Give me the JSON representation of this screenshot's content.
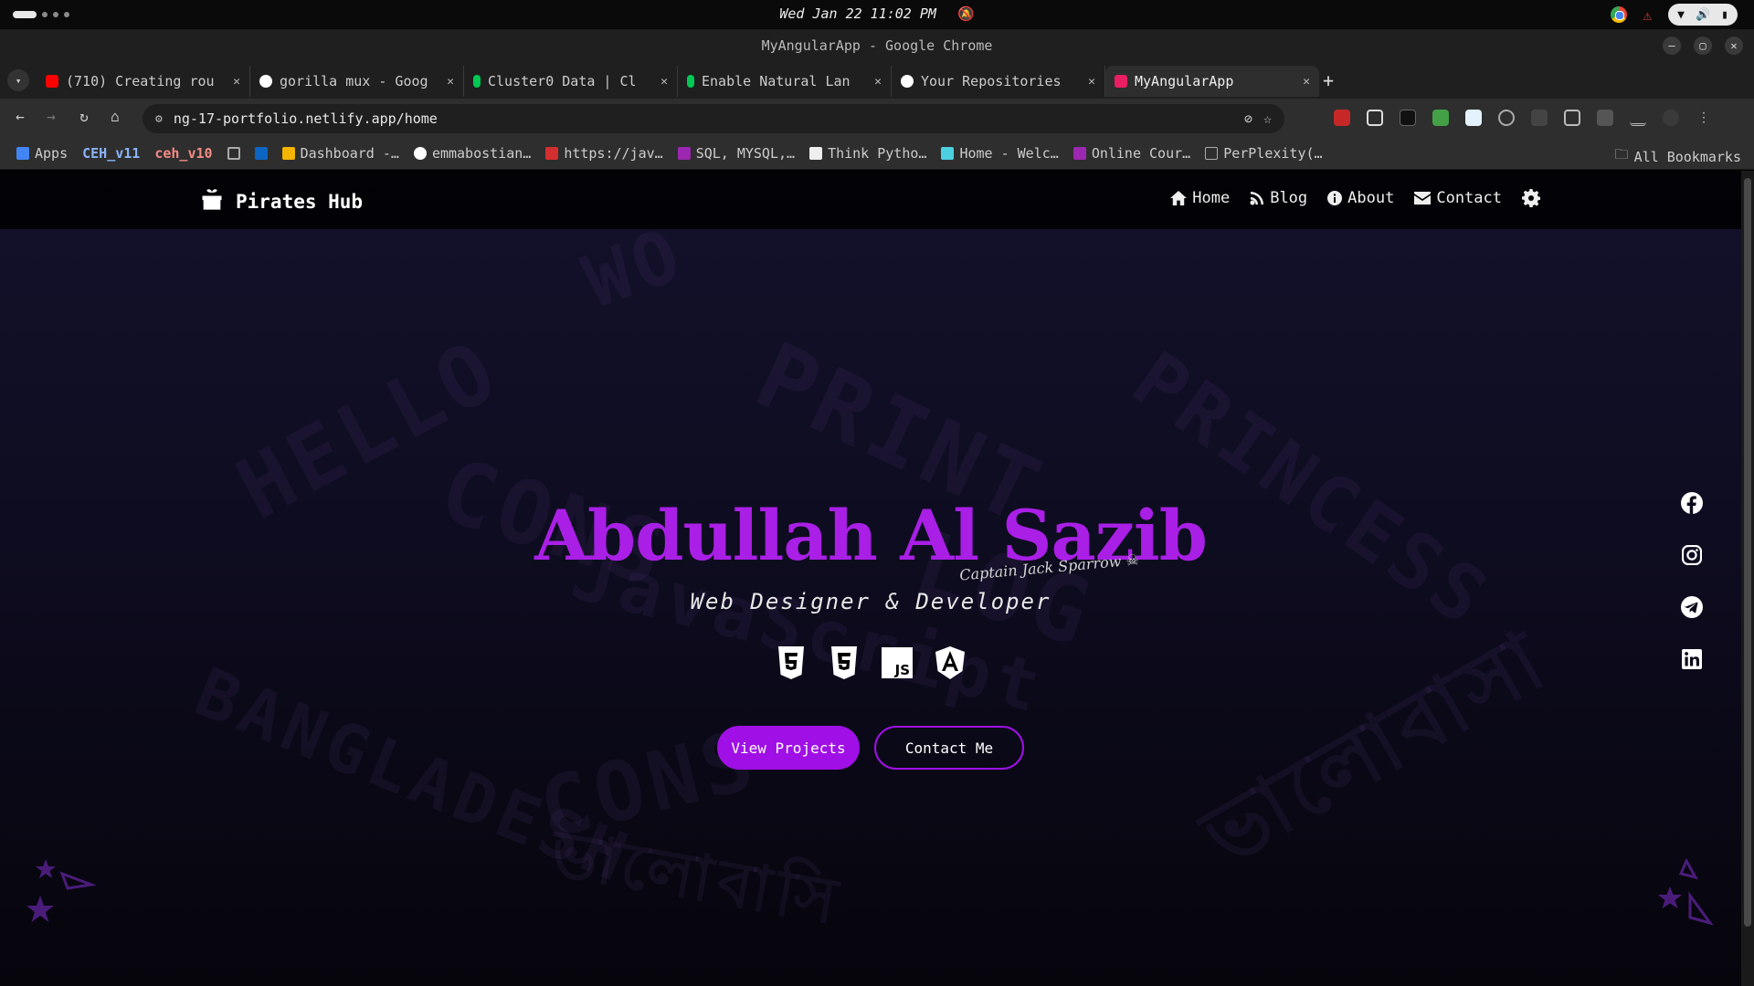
{
  "os": {
    "clock": "Wed Jan 22 11:02 PM"
  },
  "window": {
    "title": "MyAngularApp - Google Chrome"
  },
  "tabs": [
    {
      "title": "(710) Creating rou",
      "favicon_color": "#ff0000"
    },
    {
      "title": "gorilla mux - Goog",
      "favicon_color": "#ffffff"
    },
    {
      "title": "Cluster0 Data | Cl",
      "favicon_color": "#00c853"
    },
    {
      "title": "Enable Natural Lan",
      "favicon_color": "#00c853"
    },
    {
      "title": "Your Repositories",
      "favicon_color": "#ffffff"
    },
    {
      "title": "MyAngularApp",
      "favicon_color": "#e91e63"
    }
  ],
  "address": {
    "url": "ng-17-portfolio.netlify.app/home"
  },
  "bookmarks": {
    "items": [
      {
        "label": "Apps",
        "icon_color": "#4285f4"
      },
      {
        "label": "CEH_v11",
        "style": "blue"
      },
      {
        "label": "ceh_v10",
        "style": "red"
      },
      {
        "label": "",
        "icon_color": "#aaaaaa"
      },
      {
        "label": "",
        "icon_color": "#0a66c2"
      },
      {
        "label": "Dashboard -…",
        "icon_color": "#f4b400"
      },
      {
        "label": "emmabostian…",
        "icon_color": "#ffffff"
      },
      {
        "label": "https://jav…",
        "icon_color": "#d32f2f"
      },
      {
        "label": "SQL, MYSQL,…",
        "icon_color": "#9c27b0"
      },
      {
        "label": "Think Pytho…",
        "icon_color": "#eeeeee"
      },
      {
        "label": "Home - Welc…",
        "icon_color": "#4dd0e1"
      },
      {
        "label": "Online Cour…",
        "icon_color": "#9c27b0"
      },
      {
        "label": "PerPlexity(…",
        "icon_color": "#222222"
      }
    ],
    "all_label": "All Bookmarks"
  },
  "site": {
    "brand": "Pirates Hub",
    "nav": {
      "home": "Home",
      "blog": "Blog",
      "about": "About",
      "contact": "Contact"
    },
    "hero": {
      "name": "Abdullah Al Sazib",
      "tagline": "Captain Jack Sparrow",
      "role": "Web Designer & Developer"
    },
    "buttons": {
      "primary": "View Projects",
      "secondary": "Contact Me"
    },
    "background_words": [
      "HELLO",
      "WO",
      "PRINT",
      "PRINCESS",
      "CONS",
      "LOG",
      "JavaScript",
      "BANGLADESH",
      "CONS",
      "ভালোবাসা",
      "ভালোবাসি"
    ]
  },
  "colors": {
    "accent": "#a010e6",
    "name": "#a91fe6"
  }
}
